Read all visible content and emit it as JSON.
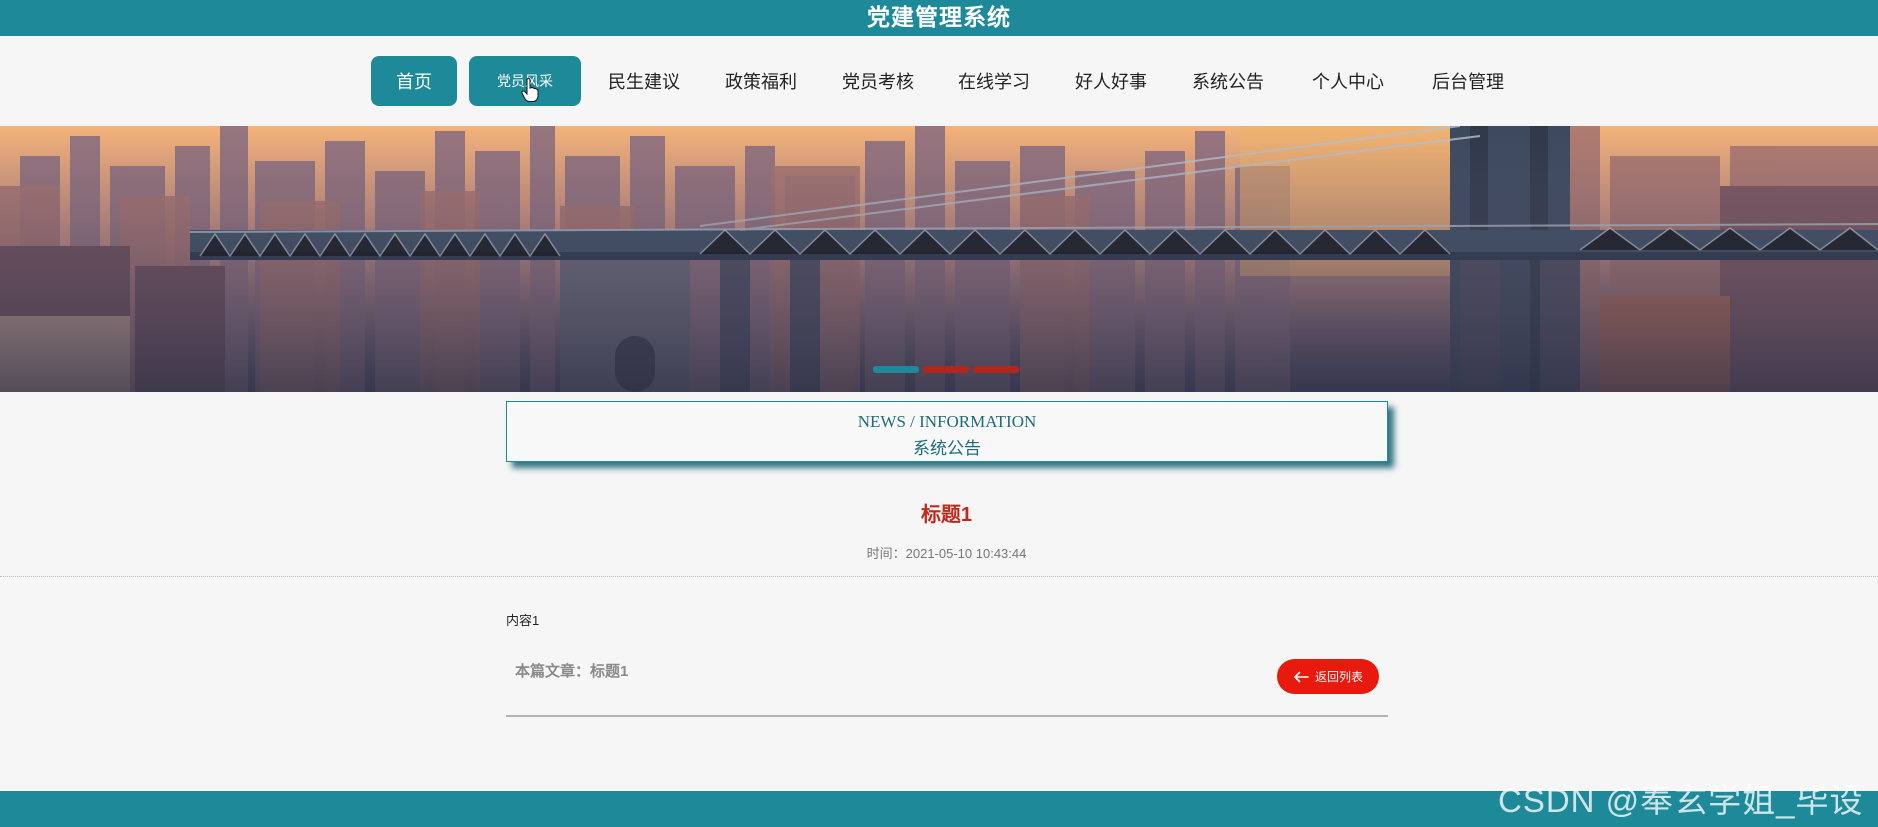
{
  "site_title": "党建管理系统",
  "nav": {
    "items": [
      "首页",
      "党员风采",
      "民生建议",
      "政策福利",
      "党员考核",
      "在线学习",
      "好人好事",
      "系统公告",
      "个人中心",
      "后台管理"
    ]
  },
  "news_section": {
    "en_title": "NEWS / INFORMATION",
    "cn_title": "系统公告"
  },
  "article": {
    "title": "标题1",
    "time": "时间：2021-05-10 10:43:44",
    "content": "内容1",
    "this_article": "本篇文章：标题1",
    "back_label": "返回列表"
  },
  "watermark": "CSDN @奉玄学姐_毕设",
  "colors": {
    "primary": "#1e8a99",
    "accent_red": "#e8190d",
    "title_red": "#c0291d"
  }
}
